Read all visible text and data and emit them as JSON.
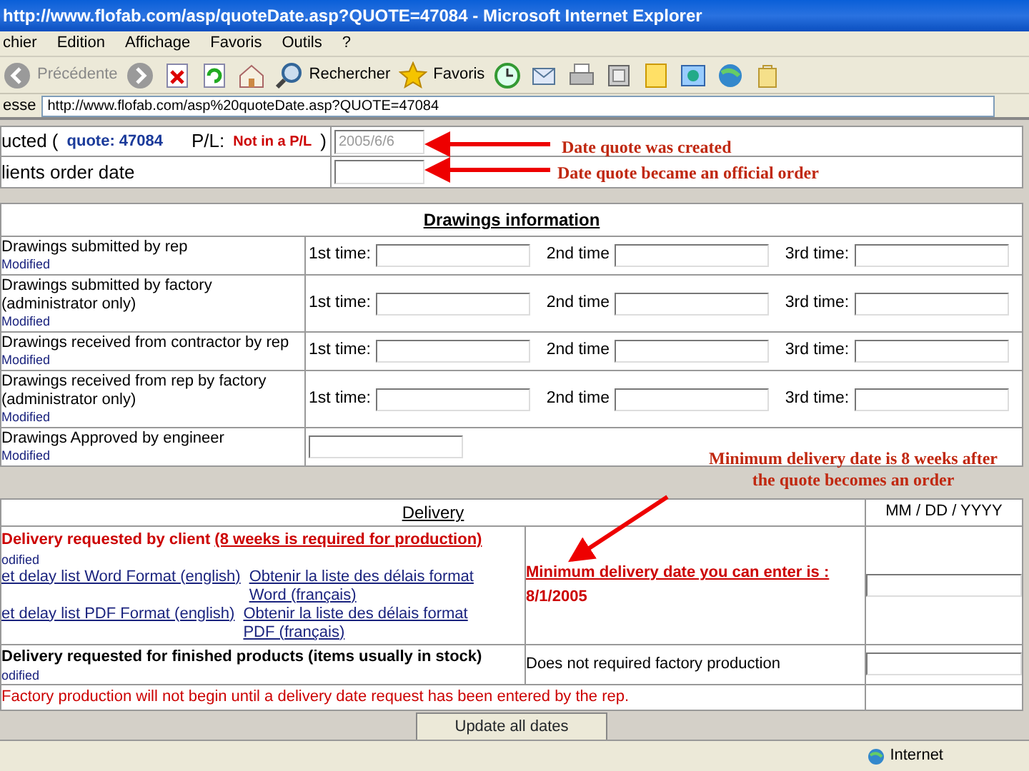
{
  "window": {
    "title": "http://www.flofab.com/asp/quoteDate.asp?QUOTE=47084 - Microsoft Internet Explorer"
  },
  "menu": [
    "chier",
    "Edition",
    "Affichage",
    "Favoris",
    "Outils",
    "?"
  ],
  "toolbar": [
    {
      "kind": "back",
      "label": "Précédente"
    },
    {
      "kind": "forward"
    },
    {
      "kind": "stop"
    },
    {
      "kind": "refresh"
    },
    {
      "kind": "home"
    },
    {
      "kind": "search",
      "label": "Rechercher"
    },
    {
      "kind": "favorites",
      "label": "Favoris"
    },
    {
      "kind": "history"
    },
    {
      "kind": "mail"
    },
    {
      "kind": "print"
    },
    {
      "kind": "edit"
    },
    {
      "kind": "note"
    },
    {
      "kind": "media"
    },
    {
      "kind": "globe"
    },
    {
      "kind": "bag"
    }
  ],
  "address": {
    "label": "esse",
    "url": "http://www.flofab.com/asp%20quoteDate.asp?QUOTE=47084"
  },
  "quote_form": {
    "label": "ucted (",
    "quote": "quote: 47084",
    "pl_label": "P/L:",
    "pl_value": "Not in a P/L",
    "close": ")",
    "created_date": "2005/6/6",
    "order_label": "lients order date"
  },
  "annotations": [
    "Date quote was created",
    "Date quote became an official order",
    "Minimum delivery date is 8 weeks after the quote becomes an order"
  ],
  "drawings": {
    "title": "Drawings information",
    "rows": [
      {
        "kind": "times",
        "label": "Drawings submitted by rep",
        "note": "Modified",
        "times": [
          "1st time:",
          "2nd time",
          "3rd time:"
        ]
      },
      {
        "kind": "times",
        "label": "Drawings submitted by factory (administrator only)",
        "note": "Modified",
        "times": [
          "1st time:",
          "2nd time",
          "3rd time:"
        ]
      },
      {
        "kind": "times",
        "label": "Drawings received from contractor by rep",
        "note": "Modified",
        "times": [
          "1st time:",
          "2nd time",
          "3rd time:"
        ]
      },
      {
        "kind": "times",
        "label": "Drawings received from rep by factory (administrator only)",
        "note": "Modified",
        "times": [
          "1st time:",
          "2nd time",
          "3rd time:"
        ]
      },
      {
        "kind": "single",
        "label": "Drawings Approved by engineer",
        "note": "Modified"
      }
    ]
  },
  "delivery": {
    "title": "Delivery",
    "date_format": "MM / DD / YYYY",
    "client": {
      "label": "Delivery requested by client",
      "link": "(8 weeks is required for production)",
      "note": "odified",
      "links": [
        "et delay list Word Format (english)",
        "Obtenir la liste des délais format Word (français)",
        "et delay list PDF Format (english)",
        "Obtenir la liste des délais format PDF (français)"
      ],
      "min_label": "Minimum delivery date you can enter is :",
      "min_date": "8/1/2005"
    },
    "stock": {
      "label": "Delivery requested for finished products (items usually in stock)",
      "note": "odified",
      "info": "Does not required factory production"
    },
    "warning": "Factory production will not begin until a delivery date request has been entered by the rep.",
    "button": "Update all dates"
  },
  "status_bar": {
    "zone": "Internet"
  }
}
